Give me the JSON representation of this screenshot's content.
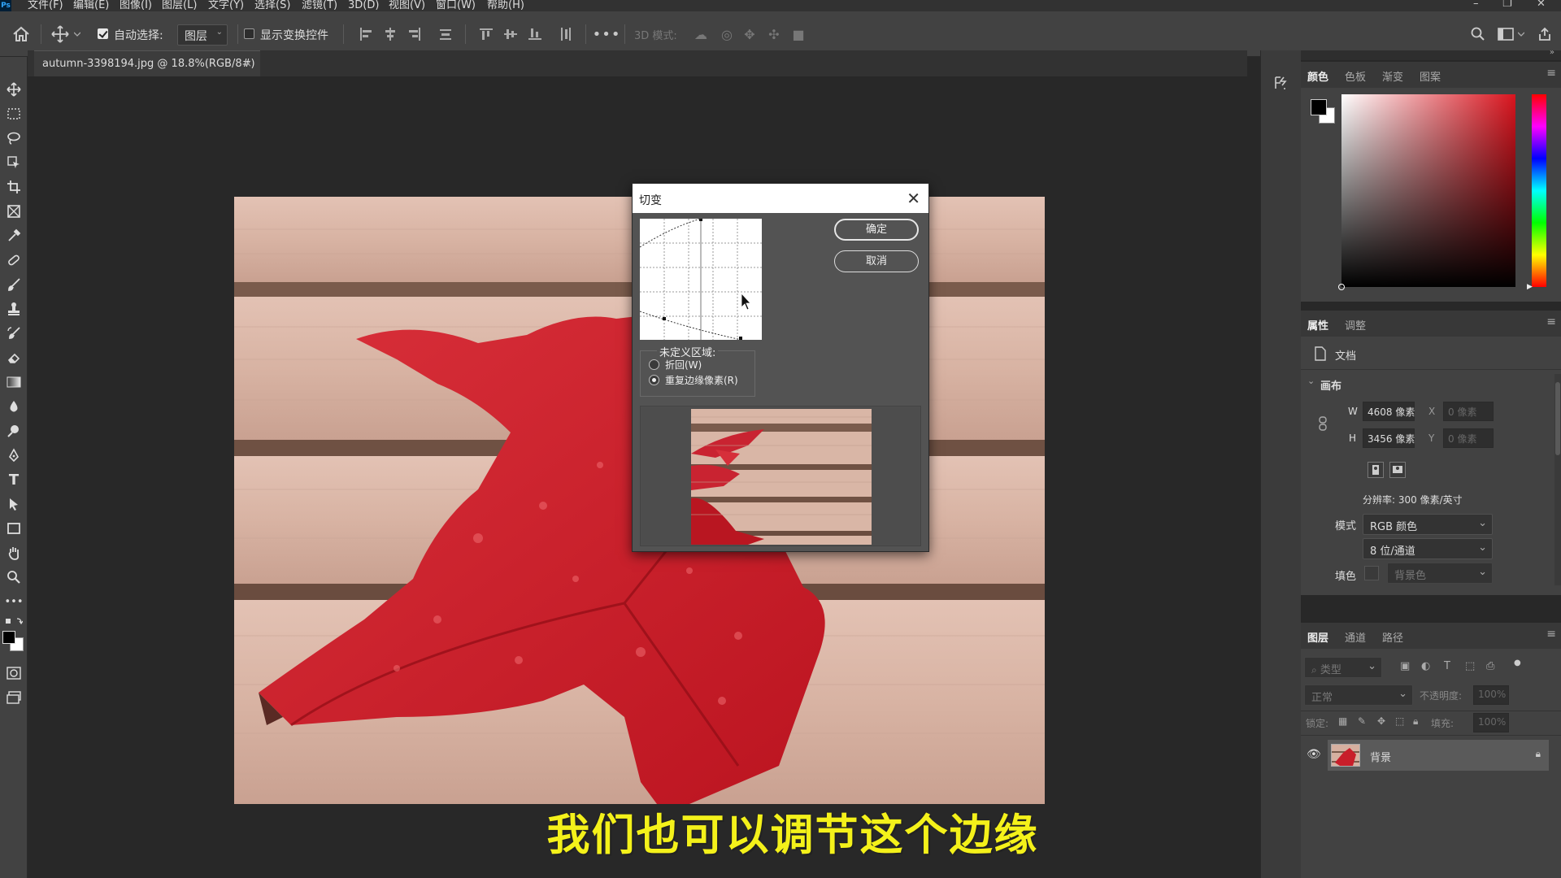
{
  "menubar": {
    "logo": "Ps",
    "items": [
      "文件(F)",
      "编辑(E)",
      "图像(I)",
      "图层(L)",
      "文字(Y)",
      "选择(S)",
      "滤镜(T)",
      "3D(D)",
      "视图(V)",
      "窗口(W)",
      "帮助(H)"
    ]
  },
  "options": {
    "auto_select_label": "自动选择:",
    "auto_select_checked": true,
    "layer_select": "图层",
    "show_transform_label": "显示变换控件",
    "mode3d_label": "3D 模式:"
  },
  "document": {
    "tab_title": "autumn-3398194.jpg @ 18.8%(RGB/8#)",
    "close_glyph": "×"
  },
  "dialog": {
    "title": "切变",
    "ok_label": "确定",
    "cancel_label": "取消",
    "undefined_area_label": "未定义区域:",
    "option_wrap": "折回(W)",
    "option_repeat": "重复边缘像素(R)",
    "selected_option": "repeat"
  },
  "subtitle": "我们也可以调节这个边缘",
  "color_panel": {
    "tabs": [
      "颜色",
      "色板",
      "渐变",
      "图案"
    ],
    "active_tab": "颜色",
    "foreground": "#000000",
    "background": "#ffffff",
    "hue_color": "#d9141e"
  },
  "properties_panel": {
    "tabs": [
      "属性",
      "调整"
    ],
    "active_tab": "属性",
    "doc_label": "文档",
    "canvas_section": "画布",
    "w_label": "W",
    "w_value": "4608 像素",
    "h_label": "H",
    "h_value": "3456 像素",
    "x_label": "X",
    "x_value": "0 像素",
    "y_label": "Y",
    "y_value": "0 像素",
    "resolution": "分辨率: 300 像素/英寸",
    "mode_label": "模式",
    "mode_value": "RGB 颜色",
    "depth_value": "8 位/通道",
    "fill_label": "填色",
    "fill_value": "背景色"
  },
  "layers_panel": {
    "tabs": [
      "图层",
      "通道",
      "路径"
    ],
    "active_tab": "图层",
    "filter_placeholder": "类型",
    "blend_mode": "正常",
    "opacity_label": "不透明度:",
    "opacity_value": "100%",
    "lock_label": "锁定:",
    "fill_label": "填充:",
    "fill_value": "100%",
    "layers": [
      {
        "name": "背景",
        "visible": true,
        "locked": true
      }
    ]
  }
}
